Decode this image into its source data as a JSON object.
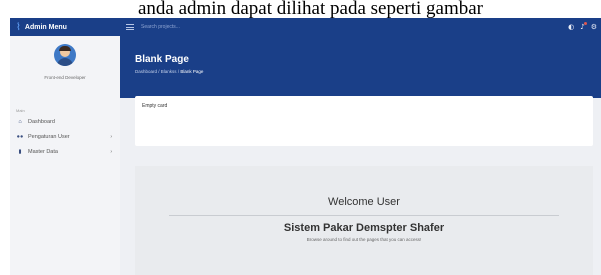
{
  "document": {
    "caption": "anda admin dapat dilihat pada seperti gambar"
  },
  "sidebar": {
    "brand": "Admin Menu",
    "profile_name": "Front-end Developer",
    "menu_heading": "Main",
    "items": [
      {
        "label": "Dashboard",
        "icon": "home-icon"
      },
      {
        "label": "Pengaturan User",
        "icon": "users-icon"
      },
      {
        "label": "Master Data",
        "icon": "database-icon"
      }
    ]
  },
  "topbar": {
    "search_placeholder": "Search projects..."
  },
  "header": {
    "title": "Blank Page",
    "breadcrumb": [
      "Dashboard",
      "Blankss",
      "Blank Page"
    ]
  },
  "card": {
    "title": "Empty card"
  },
  "welcome": {
    "title": "Welcome User",
    "subtitle": "Sistem Pakar Demspter Shafer",
    "description": "Browse around to find out the pages that you can access!"
  },
  "colors": {
    "primary": "#1a3f88",
    "sidebar_bg": "#f3f4f7",
    "content_bg": "#eef0f4"
  }
}
